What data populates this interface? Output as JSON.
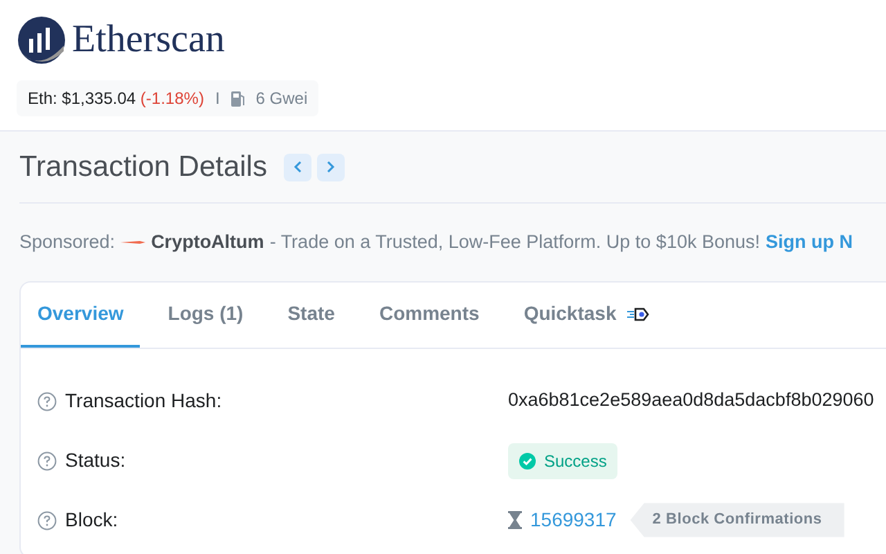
{
  "brand": "Etherscan",
  "ticker": {
    "price_label": "Eth: $1,335.04",
    "change": "(-1.18%)",
    "separator": "I",
    "gas": "6 Gwei"
  },
  "page_title": "Transaction Details",
  "sponsored": {
    "label": "Sponsored:",
    "name": "CryptoAltum",
    "text": "- Trade on a Trusted, Low-Fee Platform. Up to $10k Bonus!",
    "link": "Sign up N"
  },
  "tabs": [
    {
      "label": "Overview",
      "selected": true
    },
    {
      "label": "Logs (1)",
      "selected": false
    },
    {
      "label": "State",
      "selected": false
    },
    {
      "label": "Comments",
      "selected": false
    },
    {
      "label": "Quicktask",
      "selected": false
    }
  ],
  "fields": [
    {
      "label": "Transaction Hash:",
      "kind": "text",
      "value": "0xa6b81ce2e589aea0d8da5dacbf8b029060"
    },
    {
      "label": "Status:",
      "kind": "status",
      "value": "Success"
    },
    {
      "label": "Block:",
      "kind": "block",
      "value": "15699317",
      "confirmations": "2 Block Confirmations"
    }
  ]
}
